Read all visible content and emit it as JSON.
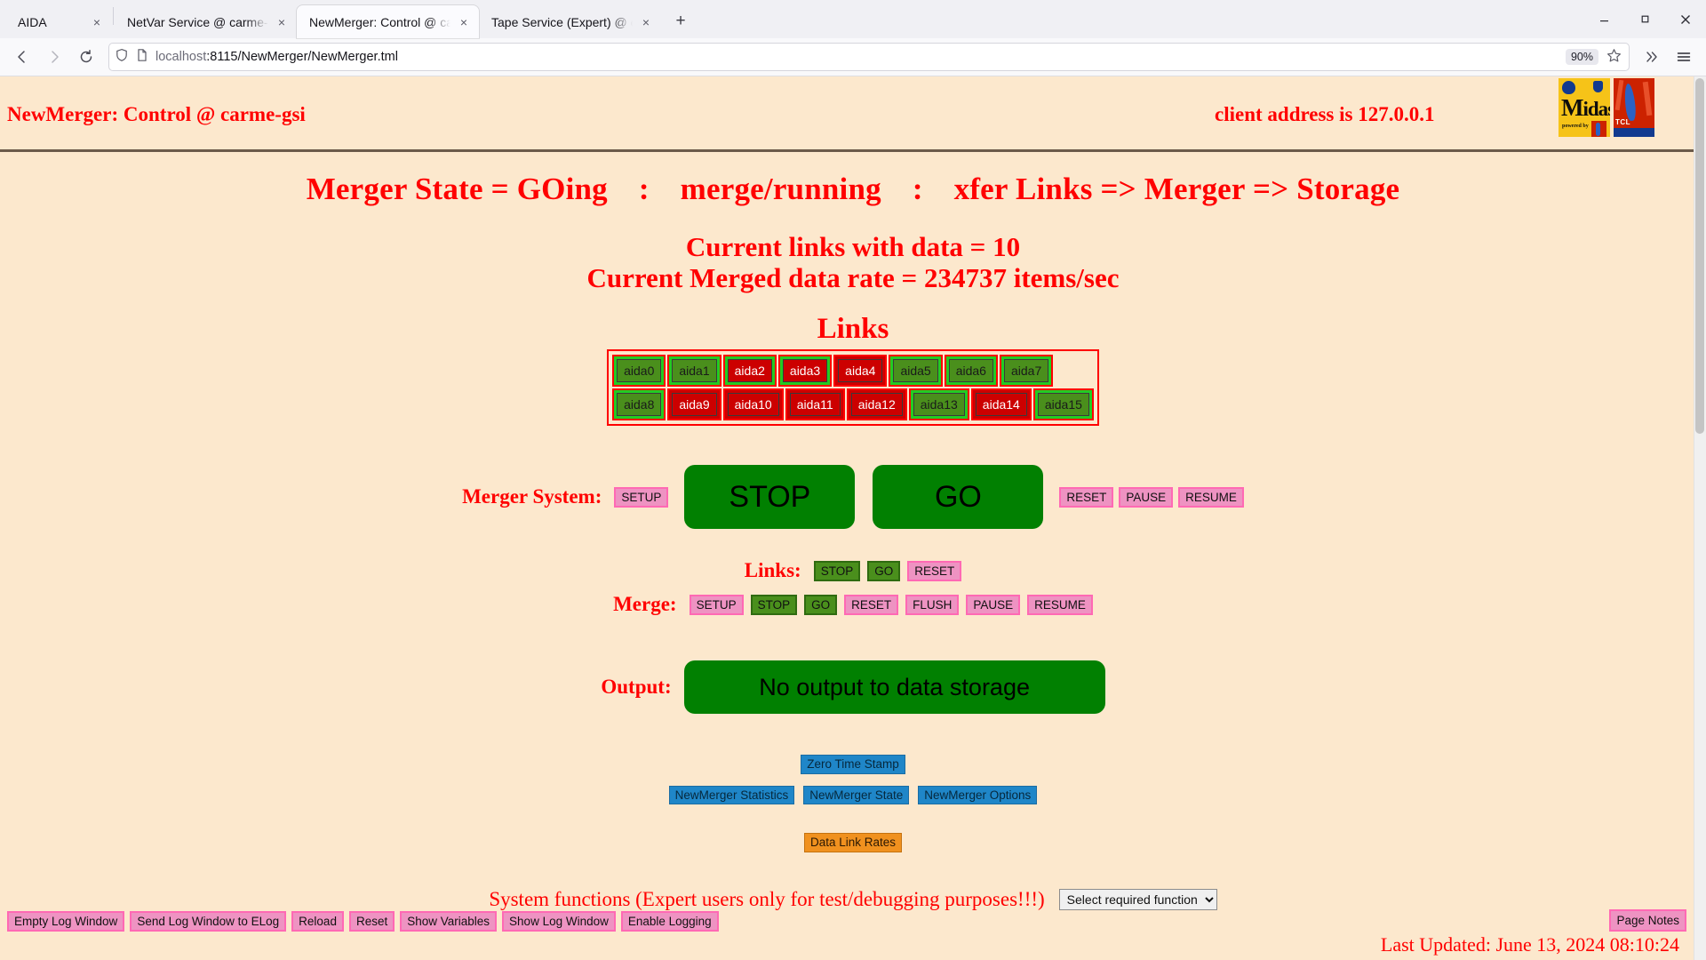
{
  "browser": {
    "tabs": [
      {
        "title": "AIDA",
        "active": false
      },
      {
        "title": "NetVar Service @ carme-gsi",
        "active": false
      },
      {
        "title": "NewMerger: Control @ carme-gsi",
        "active": true
      },
      {
        "title": "Tape Service (Expert) @ carme-gsi",
        "active": false
      }
    ],
    "new_tab_label": "+",
    "close_label": "×",
    "window_controls": {
      "minimize": "minimize-icon",
      "maximize": "maximize-icon",
      "close": "close-icon"
    },
    "nav": {
      "back": "back-arrow-icon",
      "forward": "forward-arrow-icon",
      "reload": "reload-icon"
    },
    "url": {
      "host": "localhost",
      "rest": ":8115/NewMerger/NewMerger.tml",
      "full": "localhost:8115/NewMerger/NewMerger.tml"
    },
    "zoom_level": "90%",
    "bookmark_icon": "star-icon",
    "overflow_icon": "chevron-double-right-icon",
    "menu_icon": "hamburger-menu-icon",
    "shield_icon": "shield-icon",
    "page_icon": "page-icon"
  },
  "header": {
    "title": "NewMerger: Control @ carme-gsi",
    "client_address": "client address is 127.0.0.1",
    "logo_midas": {
      "word_m": "M",
      "word_rest": "idas",
      "sub": "powered by"
    },
    "logo_tcl": {
      "word": "TCL"
    }
  },
  "status": {
    "state_label": "Merger State = GOing",
    "sep": ":",
    "state_mode": "merge/running",
    "state_path": "xfer Links => Merger => Storage",
    "current_links": "Current links with data = 10",
    "merged_rate": "Current Merged data rate = 234737 items/sec"
  },
  "links_section": {
    "title": "Links",
    "rows": [
      [
        {
          "label": "aida0",
          "cell": "on",
          "inner": "ok"
        },
        {
          "label": "aida1",
          "cell": "on",
          "inner": "ok"
        },
        {
          "label": "aida2",
          "cell": "on",
          "inner": "bad"
        },
        {
          "label": "aida3",
          "cell": "on",
          "inner": "bad"
        },
        {
          "label": "aida4",
          "cell": "off",
          "inner": "bad"
        },
        {
          "label": "aida5",
          "cell": "on",
          "inner": "ok"
        },
        {
          "label": "aida6",
          "cell": "on",
          "inner": "ok"
        },
        {
          "label": "aida7",
          "cell": "on",
          "inner": "ok"
        }
      ],
      [
        {
          "label": "aida8",
          "cell": "on",
          "inner": "ok"
        },
        {
          "label": "aida9",
          "cell": "off",
          "inner": "bad"
        },
        {
          "label": "aida10",
          "cell": "off",
          "inner": "bad"
        },
        {
          "label": "aida11",
          "cell": "off",
          "inner": "bad"
        },
        {
          "label": "aida12",
          "cell": "off",
          "inner": "bad"
        },
        {
          "label": "aida13",
          "cell": "on",
          "inner": "ok"
        },
        {
          "label": "aida14",
          "cell": "off",
          "inner": "bad"
        },
        {
          "label": "aida15",
          "cell": "on",
          "inner": "ok"
        }
      ]
    ]
  },
  "merger_system": {
    "label": "Merger System:",
    "setup": "SETUP",
    "stop": "STOP",
    "go": "GO",
    "reset": "RESET",
    "pause": "PAUSE",
    "resume": "RESUME"
  },
  "links_controls": {
    "label": "Links:",
    "stop": "STOP",
    "go": "GO",
    "reset": "RESET"
  },
  "merge_controls": {
    "label": "Merge:",
    "setup": "SETUP",
    "stop": "STOP",
    "go": "GO",
    "reset": "RESET",
    "flush": "FLUSH",
    "pause": "PAUSE",
    "resume": "RESUME"
  },
  "output": {
    "label": "Output:",
    "value": "No output to data storage"
  },
  "actions": {
    "zero_time_stamp": "Zero Time Stamp",
    "statistics": "NewMerger Statistics",
    "state": "NewMerger State",
    "options": "NewMerger Options",
    "data_link_rates": "Data Link Rates"
  },
  "system_functions": {
    "label": "System functions (Expert users only for test/debugging purposes!!!)",
    "select_value": "Select required function"
  },
  "footer": {
    "empty_log_window": "Empty Log Window",
    "send_log_to_elog": "Send Log Window to ELog",
    "reload": "Reload",
    "reset": "Reset",
    "show_variables": "Show Variables",
    "show_log_window": "Show Log Window",
    "enable_logging": "Enable Logging",
    "page_notes": "Page Notes",
    "last_updated": "Last Updated: June 13, 2024 08:10:24"
  },
  "colors": {
    "page_bg": "#fce8cd",
    "accent_red": "#ff0000",
    "green_ok": "#22cc22",
    "red_bad": "#cc0000",
    "big_green": "#018001",
    "pink": "#ee93c2",
    "blue": "#1f86c8",
    "orange": "#f0911f"
  }
}
